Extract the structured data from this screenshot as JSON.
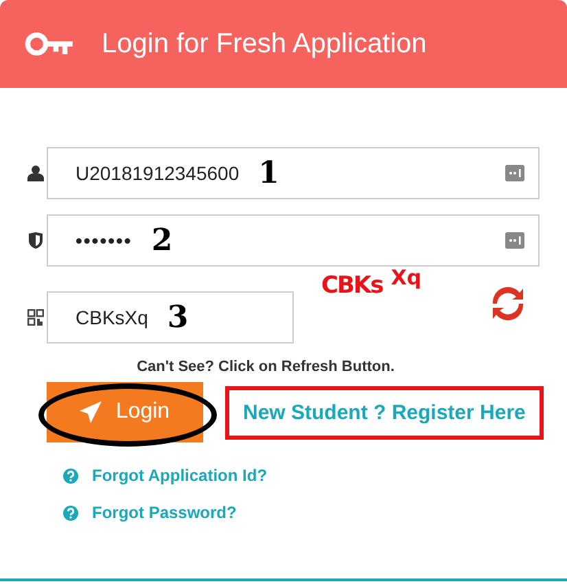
{
  "header": {
    "title": "Login for Fresh Application"
  },
  "fields": [
    {
      "kind": "user",
      "value": "U20181912345600",
      "marker": "1",
      "autofill": true
    },
    {
      "kind": "password",
      "value": "•••••••",
      "marker": "2",
      "autofill": true
    }
  ],
  "captcha": {
    "value": "CBKsXq",
    "marker": "3",
    "image_text_1": "CBKs",
    "image_text_2": "Xq"
  },
  "hint": "Can't See? Click on Refresh Button.",
  "login_button": {
    "label": "Login",
    "circled": true
  },
  "register_link": {
    "label": "New Student ? Register Here",
    "boxed": true
  },
  "links": [
    "Forgot Application Id?",
    "Forgot Password?"
  ]
}
